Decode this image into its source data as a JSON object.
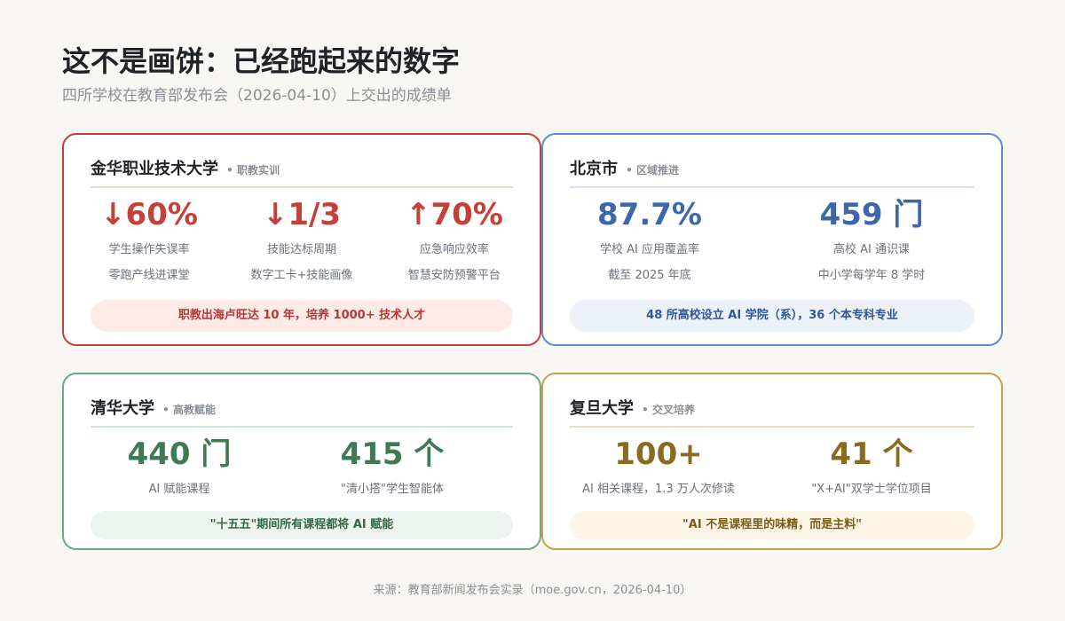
{
  "header": {
    "title": "这不是画饼：已经跑起来的数字",
    "subtitle": "四所学校在教育部发布会（2026-04-10）上交出的成绩单"
  },
  "cards": [
    {
      "name": "金华职业技术大学",
      "tag": "• 职教实训",
      "metrics": [
        {
          "value": "↓60%",
          "label": "学生操作失误率",
          "sub": "零跑产线进课堂"
        },
        {
          "value": "↓1/3",
          "label": "技能达标周期",
          "sub": "数字工卡+技能画像"
        },
        {
          "value": "↑70%",
          "label": "应急响应效率",
          "sub": "智慧安防预警平台"
        }
      ],
      "banner": "职教出海卢旺达 10 年，培养 1000+ 技术人才",
      "colors": {
        "accent": "#c4413a",
        "banner_bg": "#fdeae6"
      }
    },
    {
      "name": "北京市",
      "tag": "• 区域推进",
      "metrics": [
        {
          "value": "87.7%",
          "label": "学校 AI 应用覆盖率",
          "sub": "截至 2025 年底"
        },
        {
          "value": "459 门",
          "label": "高校 AI 通识课",
          "sub": "中小学每学年 8 学时"
        }
      ],
      "banner": "48 所高校设立 AI 学院（系），36 个本专科专业",
      "colors": {
        "accent": "#3d67a8",
        "banner_bg": "#ecf1f8"
      }
    },
    {
      "name": "清华大学",
      "tag": "• 高教赋能",
      "metrics": [
        {
          "value": "440 门",
          "label": "AI 赋能课程"
        },
        {
          "value": "415 个",
          "label": "\"清小搭\"学生智能体"
        }
      ],
      "banner": "\"十五五\"期间所有课程都将 AI 赋能",
      "colors": {
        "accent": "#3f7a54",
        "banner_bg": "#edf4ef"
      }
    },
    {
      "name": "复旦大学",
      "tag": "• 交叉培养",
      "metrics": [
        {
          "value": "100+",
          "label": "AI 相关课程，1.3 万人次修读"
        },
        {
          "value": "41 个",
          "label": "\"X+AI\"双学士学位项目"
        }
      ],
      "banner": "\"AI 不是课程里的味精，而是主料\"",
      "colors": {
        "accent": "#8a6a1e",
        "banner_bg": "#fcf4e5"
      }
    }
  ],
  "footer": {
    "source": "来源：教育部新闻发布会实录（moe.gov.cn，2026-04-10）"
  }
}
